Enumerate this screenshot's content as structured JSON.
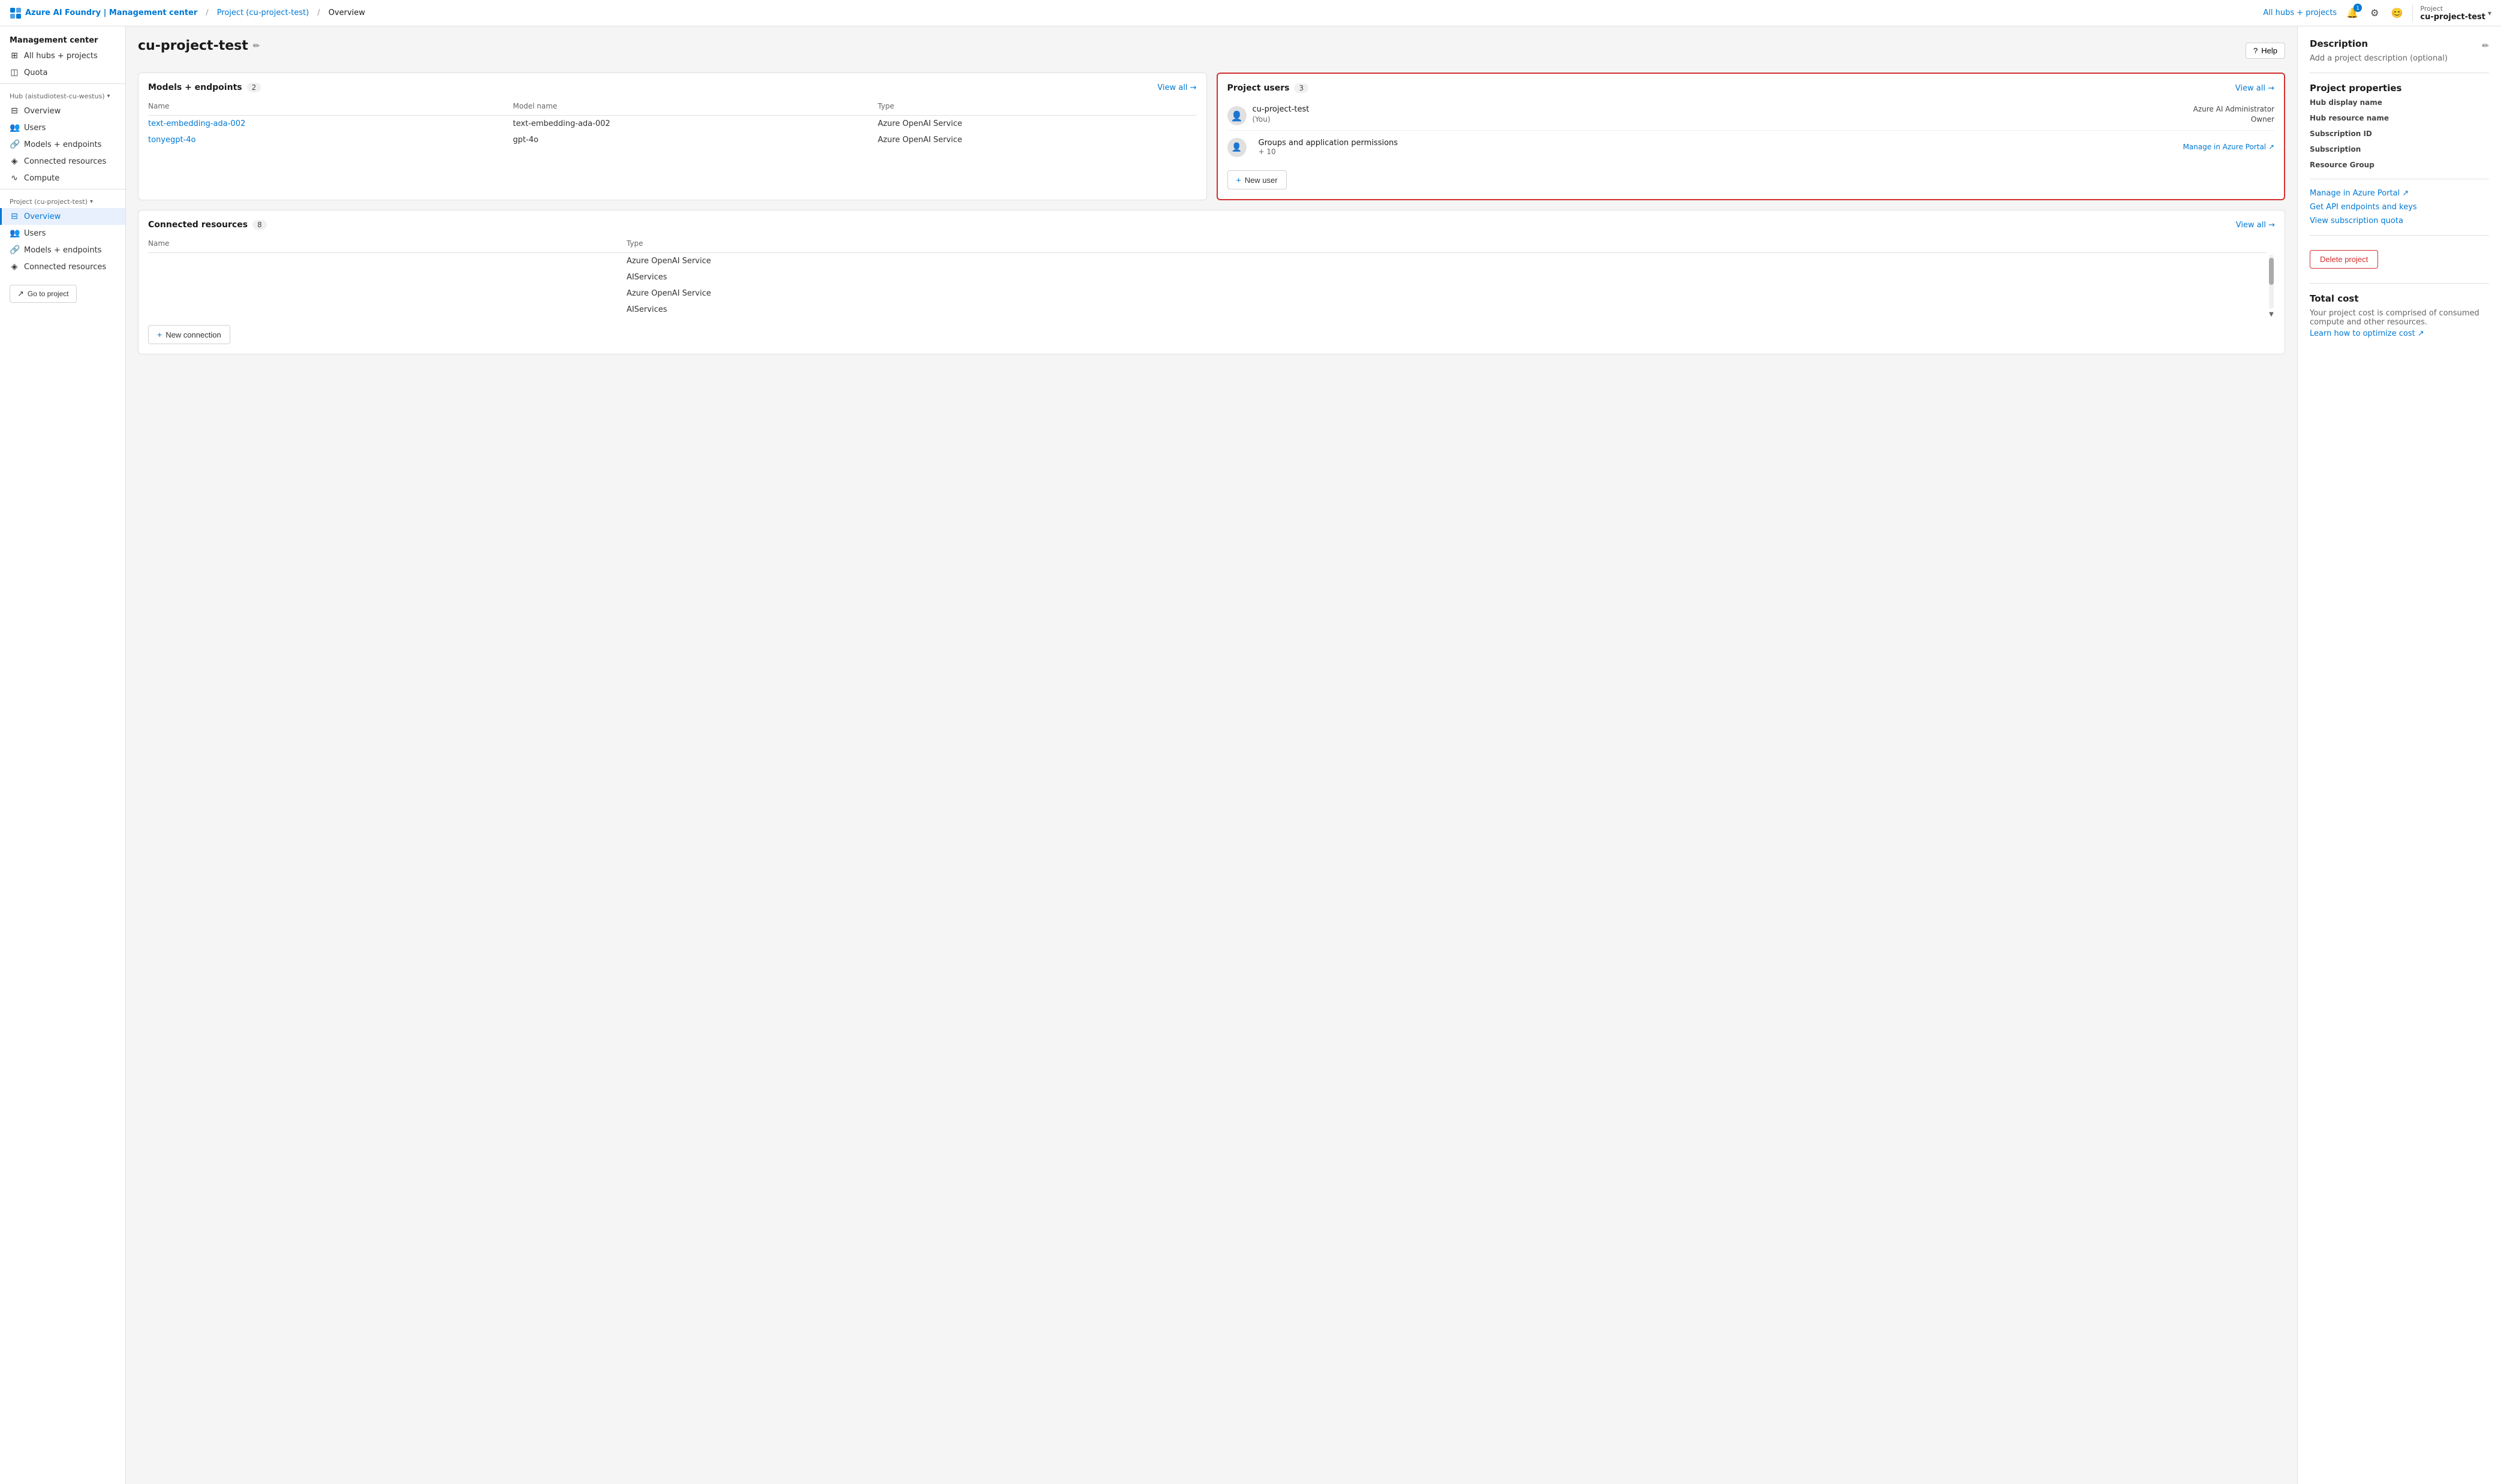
{
  "topnav": {
    "logo_text": "Azure AI Foundry | Management center",
    "breadcrumb1": "Project (cu-project-test)",
    "breadcrumb2": "Overview",
    "right_text": "All hubs + projects",
    "notification_count": "1",
    "project_label": "Project",
    "project_name": "cu-project-test",
    "help_label": "Help"
  },
  "sidebar": {
    "section_title": "Management center",
    "top_items": [
      {
        "id": "all-hubs",
        "label": "All hubs + projects",
        "icon": "⊞"
      },
      {
        "id": "quota",
        "label": "Quota",
        "icon": "◫"
      }
    ],
    "hub_group": "Hub (aistudiotest-cu-westus)",
    "hub_items": [
      {
        "id": "hub-overview",
        "label": "Overview",
        "icon": "⊟"
      },
      {
        "id": "hub-users",
        "label": "Users",
        "icon": "👥"
      },
      {
        "id": "hub-models",
        "label": "Models + endpoints",
        "icon": "🔗"
      },
      {
        "id": "hub-connected",
        "label": "Connected resources",
        "icon": "◈"
      },
      {
        "id": "hub-compute",
        "label": "Compute",
        "icon": "∿"
      }
    ],
    "project_group": "Project (cu-project-test)",
    "project_items": [
      {
        "id": "proj-overview",
        "label": "Overview",
        "icon": "⊟",
        "active": true
      },
      {
        "id": "proj-users",
        "label": "Users",
        "icon": "👥"
      },
      {
        "id": "proj-models",
        "label": "Models + endpoints",
        "icon": "🔗"
      },
      {
        "id": "proj-connected",
        "label": "Connected resources",
        "icon": "◈"
      }
    ],
    "go_project_label": "Go to project"
  },
  "page": {
    "title": "cu-project-test"
  },
  "models_card": {
    "title": "Models + endpoints",
    "count": "2",
    "view_all": "View all →",
    "col_name": "Name",
    "col_model": "Model name",
    "col_type": "Type",
    "rows": [
      {
        "name": "text-embedding-ada-002",
        "model": "text-embedding-ada-002",
        "type": "Azure OpenAI Service"
      },
      {
        "name": "tonyegpt-4o",
        "model": "gpt-4o",
        "type": "Azure OpenAI Service"
      }
    ]
  },
  "project_users_card": {
    "title": "Project users",
    "count": "3",
    "view_all": "View all →",
    "users": [
      {
        "name": "cu-project-test",
        "sub": "(You)",
        "role": "Azure AI Administrator",
        "role2": "Owner"
      }
    ],
    "groups": {
      "name": "Groups and application permissions",
      "count": "+ 10",
      "manage_label": "Manage in Azure Portal ↗"
    },
    "new_user_label": "New user"
  },
  "connected_card": {
    "title": "Connected resources",
    "count": "8",
    "view_all": "View all →",
    "col_name": "Name",
    "col_type": "Type",
    "rows": [
      {
        "name": "",
        "type": "Azure OpenAI Service"
      },
      {
        "name": "",
        "type": "AIServices"
      },
      {
        "name": "",
        "type": "Azure OpenAI Service"
      },
      {
        "name": "",
        "type": "AIServices"
      }
    ],
    "new_connection_label": "New connection"
  },
  "right_panel": {
    "description_title": "Description",
    "description_text": "Add a project description (optional)",
    "properties_title": "Project properties",
    "hub_display_label": "Hub display name",
    "hub_display_value": "",
    "hub_resource_label": "Hub resource name",
    "hub_resource_value": "",
    "subscription_id_label": "Subscription ID",
    "subscription_id_value": "",
    "subscription_label": "Subscription",
    "subscription_value": "",
    "resource_group_label": "Resource Group",
    "resource_group_value": "",
    "manage_portal_label": "Manage in Azure Portal ↗",
    "get_api_label": "Get API endpoints and keys",
    "view_quota_label": "View subscription quota",
    "delete_label": "Delete project",
    "total_cost_title": "Total cost",
    "total_cost_desc": "Your project cost is comprised of consumed compute and other resources.",
    "learn_more_label": "Learn how to optimize cost ↗"
  }
}
